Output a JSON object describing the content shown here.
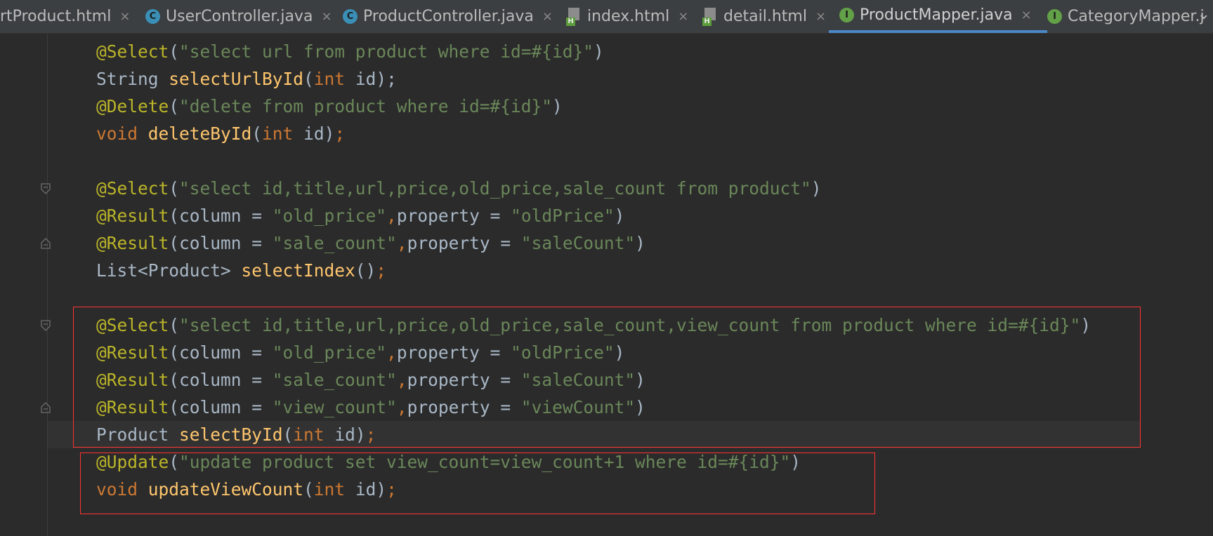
{
  "tabs": [
    {
      "label": "rtProduct.html",
      "icon": "none",
      "active": false
    },
    {
      "label": "UserController.java",
      "icon": "class-icon",
      "active": false
    },
    {
      "label": "ProductController.java",
      "icon": "class-icon",
      "active": false
    },
    {
      "label": "index.html",
      "icon": "html-file-icon",
      "active": false
    },
    {
      "label": "detail.html",
      "icon": "html-file-icon",
      "active": false
    },
    {
      "label": "ProductMapper.java",
      "icon": "interface-icon",
      "active": true
    },
    {
      "label": "CategoryMapper.j",
      "icon": "interface-icon",
      "active": false
    }
  ],
  "icon_letters": {
    "class": "C",
    "interface": "I",
    "html": "H"
  },
  "close_glyph": "×",
  "overflow_glyph": "⌄",
  "code": {
    "l1": {
      "a": "@Select",
      "b": "(",
      "c": "\"select url from product where id=#{id}\"",
      "d": ")"
    },
    "l2": {
      "a": "String ",
      "b": "selectUrlById",
      "c": "(",
      "d": "int ",
      "e": "id);"
    },
    "l3": {
      "a": "@Delete",
      "b": "(",
      "c": "\"delete from product where id=#{id}\"",
      "d": ")"
    },
    "l4": {
      "a": "void ",
      "b": "deleteById",
      "c": "(",
      "d": "int ",
      "e": "id)",
      "f": ";"
    },
    "l5": {
      "a": "@Select",
      "b": "(",
      "c": "\"select id,title,url,price,old_price,sale_count from product\"",
      "d": ")"
    },
    "l6": {
      "a": "@Result",
      "b": "(column = ",
      "c": "\"old_price\"",
      "d": ",",
      "e": "property = ",
      "f": "\"oldPrice\"",
      "g": ")"
    },
    "l7": {
      "a": "@Result",
      "b": "(column = ",
      "c": "\"sale_count\"",
      "d": ",",
      "e": "property = ",
      "f": "\"saleCount\"",
      "g": ")"
    },
    "l8": {
      "a": "List<Product> ",
      "b": "selectIndex",
      "c": "()",
      "d": ";"
    },
    "l9": {
      "a": "@Select",
      "b": "(",
      "c": "\"select id,title,url,price,old_price,sale_count,view_count from product where id=#{id}\"",
      "d": ")"
    },
    "l10": {
      "a": "@Result",
      "b": "(column = ",
      "c": "\"old_price\"",
      "d": ",",
      "e": "property = ",
      "f": "\"oldPrice\"",
      "g": ")"
    },
    "l11": {
      "a": "@Result",
      "b": "(column = ",
      "c": "\"sale_count\"",
      "d": ",",
      "e": "property = ",
      "f": "\"saleCount\"",
      "g": ")"
    },
    "l12": {
      "a": "@Result",
      "b": "(column = ",
      "c": "\"view_count\"",
      "d": ",",
      "e": "property = ",
      "f": "\"viewCount\"",
      "g": ")"
    },
    "l13": {
      "a": "Product ",
      "b": "selectById",
      "c": "(",
      "d": "int ",
      "e": "id)",
      "f": ";"
    },
    "l14": {
      "a": "@Update",
      "b": "(",
      "c": "\"update product set view_count=view_count+1 where id=#{id}\"",
      "d": ")"
    },
    "l15": {
      "a": "void ",
      "b": "updateViewCount",
      "c": "(",
      "d": "int ",
      "e": "id)",
      "f": ";"
    }
  },
  "colors": {
    "background": "#2b2b2b",
    "annotation": "#bbb529",
    "string": "#6a8759",
    "keyword": "#cc7832",
    "method": "#ffc66d",
    "identifier": "#a9b7c6",
    "highlight_box": "#ff3333",
    "active_tab_underline": "#4a88c7"
  }
}
